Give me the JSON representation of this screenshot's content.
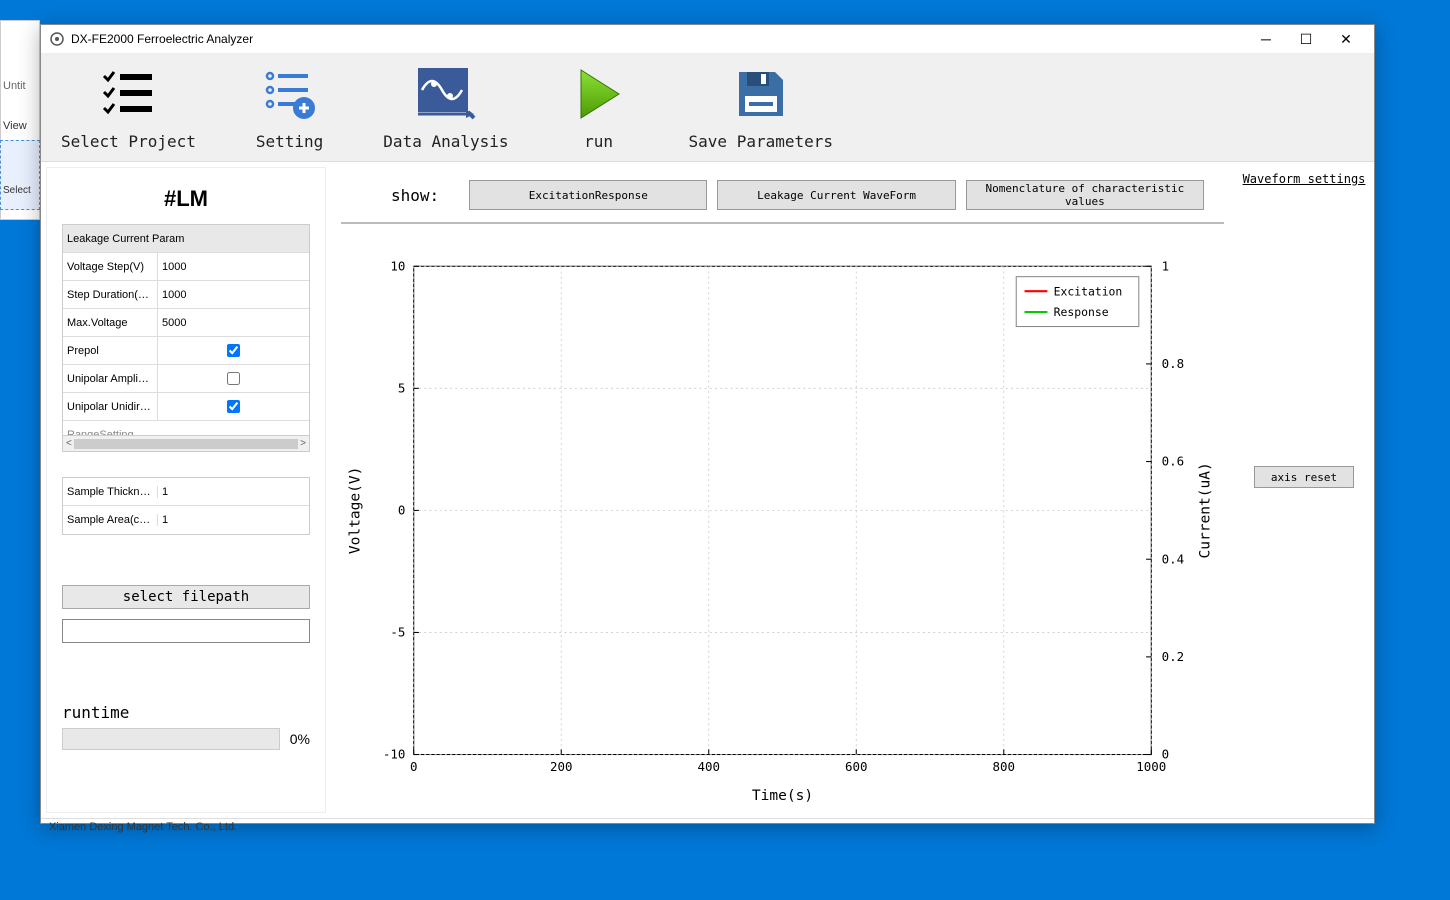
{
  "bg": {
    "untitled": "Untit",
    "view": "View",
    "select": "Select"
  },
  "window": {
    "title": "DX-FE2000 Ferroelectric Analyzer"
  },
  "toolbar": {
    "select_project": "Select Project",
    "setting": "Setting",
    "data_analysis": "Data Analysis",
    "run": "run",
    "save_params": "Save Parameters"
  },
  "left": {
    "header": "#LM",
    "params_header": "Leakage Current Param",
    "params": [
      {
        "label": "Voltage Step(V)",
        "value": "1000"
      },
      {
        "label": "Step Duration(…",
        "value": "1000"
      },
      {
        "label": "Max.Voltage",
        "value": "5000"
      }
    ],
    "checks": [
      {
        "label": "Prepol",
        "checked": true
      },
      {
        "label": "Unipolar Ampli…",
        "checked": false
      },
      {
        "label": "Unipolar Unidir…",
        "checked": true
      }
    ],
    "range_label": "RangeSetting",
    "sample": [
      {
        "label": "Sample Thickne…",
        "value": "1"
      },
      {
        "label": "Sample Area(c…",
        "value": "1"
      }
    ],
    "filepath_btn": "select filepath",
    "filepath_value": "",
    "runtime_label": "runtime",
    "runtime_pct": "0%"
  },
  "center": {
    "show_label": "show:",
    "buttons": {
      "excitation": "ExcitationResponse",
      "leakage": "Leakage Current WaveForm",
      "nomenclature": "Nomenclature of characteristic values"
    }
  },
  "right": {
    "waveform_settings": "Waveform settings",
    "axis_reset": "axis reset"
  },
  "status": {
    "company": "Xiamen Dexing Magnet Tech. Co., Ltd."
  },
  "chart_data": {
    "type": "line",
    "title": "",
    "xlabel": "Time(s)",
    "ylabel_left": "Voltage(V)",
    "ylabel_right": "Current(uA)",
    "xlim": [
      0,
      1000
    ],
    "ylim_left": [
      -10,
      10
    ],
    "ylim_right": [
      0,
      1
    ],
    "x_ticks": [
      0,
      200,
      400,
      600,
      800,
      1000
    ],
    "y_ticks_left": [
      -10,
      -5,
      0,
      5,
      10
    ],
    "y_ticks_right": [
      0,
      0.2,
      0.4,
      0.6,
      0.8,
      1
    ],
    "legend": [
      {
        "name": "Excitation",
        "color": "#ff0000"
      },
      {
        "name": "Response",
        "color": "#00cc00"
      }
    ],
    "series": [
      {
        "name": "Excitation",
        "color": "#ff0000",
        "x": [],
        "y": []
      },
      {
        "name": "Response",
        "color": "#00cc00",
        "x": [],
        "y": []
      }
    ]
  }
}
